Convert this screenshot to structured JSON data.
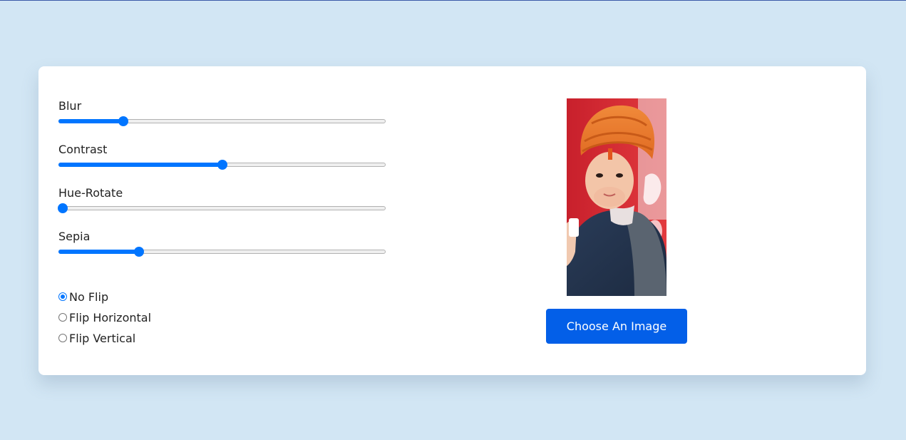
{
  "sliders": [
    {
      "label": "Blur",
      "value": 0.19
    },
    {
      "label": "Contrast",
      "value": 0.5
    },
    {
      "label": "Hue-Rotate",
      "value": 0.0
    },
    {
      "label": "Sepia",
      "value": 0.24
    }
  ],
  "flip": {
    "options": [
      {
        "label": "No Flip",
        "checked": true
      },
      {
        "label": "Flip Horizontal",
        "checked": false
      },
      {
        "label": "Flip Vertical",
        "checked": false
      }
    ]
  },
  "preview": {
    "image_icon": "portrait-photo"
  },
  "choose_button": {
    "label": "Choose An Image"
  },
  "colors": {
    "accent": "#0075ff",
    "button": "#035fe8",
    "background": "#d2e6f4"
  }
}
